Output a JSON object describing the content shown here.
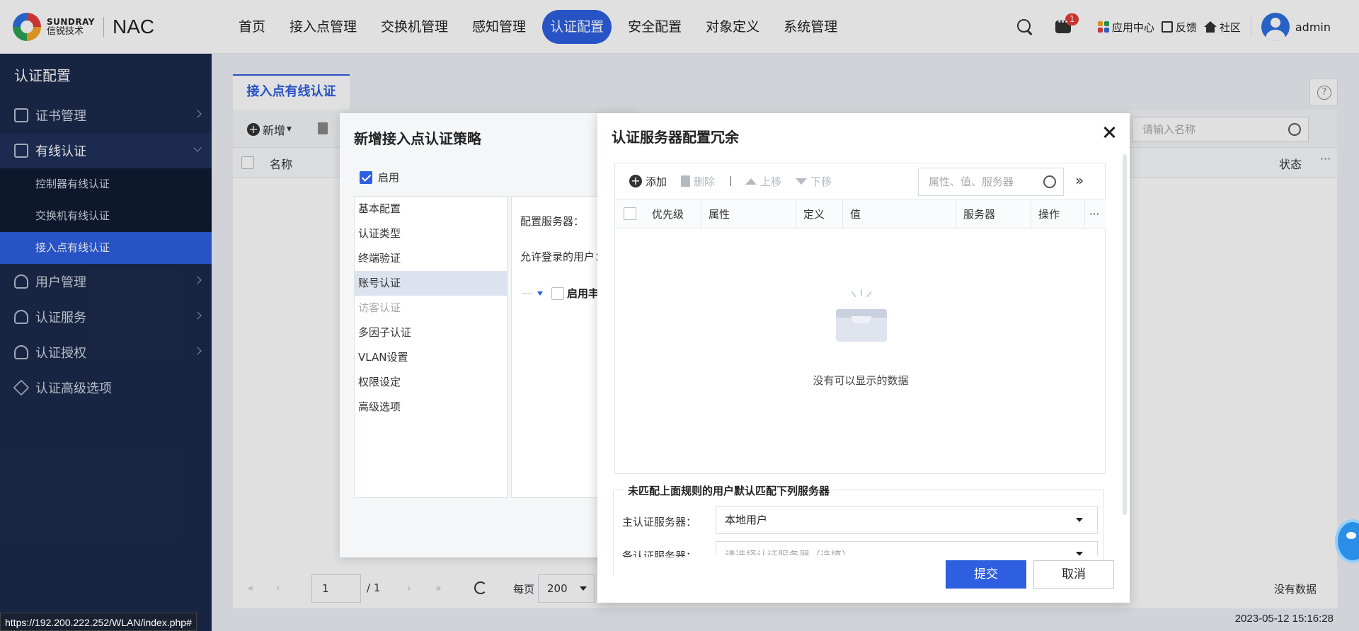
{
  "header": {
    "brand_en": "SUNDRAY",
    "brand_cn": "信锐技术",
    "product": "NAC",
    "nav": [
      "首页",
      "接入点管理",
      "交换机管理",
      "感知管理",
      "认证配置",
      "安全配置",
      "对象定义",
      "系统管理"
    ],
    "nav_active_index": 4,
    "badge_count": "1",
    "app_center": "应用中心",
    "feedback": "反馈",
    "community": "社区",
    "user": "admin"
  },
  "sidebar": {
    "title": "认证配置",
    "items": [
      {
        "label": "证书管理",
        "icon": "certificate-icon"
      },
      {
        "label": "有线认证",
        "icon": "wired-icon",
        "open": true
      },
      {
        "label": "用户管理",
        "icon": "user-icon"
      },
      {
        "label": "认证服务",
        "icon": "user-service-icon"
      },
      {
        "label": "认证授权",
        "icon": "user-auth-icon"
      },
      {
        "label": "认证高级选项",
        "icon": "diamond-icon"
      }
    ],
    "sub_items": [
      "控制器有线认证",
      "交换机有线认证",
      "接入点有线认证"
    ],
    "sub_active_index": 2
  },
  "status_url": "https://192.200.222.252/WLAN/index.php#",
  "main": {
    "tab": "接入点有线认证",
    "toolbar_add": "新增",
    "search_placeholder": "请输入名称",
    "col_name": "名称",
    "col_status": "状态",
    "pager": {
      "page": "1",
      "total": "/ 1",
      "per_page_label": "每页",
      "page_size": "200",
      "no_data": "没有数据"
    }
  },
  "dialog_policy": {
    "title": "新增接入点认证策略",
    "enable_label": "启用",
    "enabled": true,
    "menu": [
      "基本配置",
      "认证类型",
      "终端验证",
      "账号认证",
      "访客认证",
      "多因子认证",
      "VLAN设置",
      "权限设定",
      "高级选项"
    ],
    "menu_active_index": 3,
    "menu_disabled_index": 4,
    "content_server_label": "配置服务器：",
    "content_users_label": "允许登录的用户：",
    "content_enable_partial": "启用丰"
  },
  "dialog_redundancy": {
    "title": "认证服务器配置冗余",
    "toolbar": {
      "add": "添加",
      "delete": "删除",
      "move_up": "上移",
      "move_down": "下移",
      "search_placeholder": "属性、值、服务器",
      "expand": "»"
    },
    "columns": [
      "优先级",
      "属性",
      "定义",
      "值",
      "服务器",
      "操作",
      "···"
    ],
    "empty_text": "没有可以显示的数据",
    "fallback_legend": "未匹配上面规则的用户默认匹配下列服务器",
    "primary_label": "主认证服务器：",
    "primary_value": "本地用户",
    "backup_label": "备认证服务器：",
    "backup_placeholder": "请选择认证服务器（选填）",
    "submit": "提交",
    "cancel": "取消"
  },
  "datetime": "2023-05-12 15:16:28",
  "colors": {
    "accent": "#2d5fe0",
    "sidebar_bg": "#1c2b4c",
    "sub_bg": "#111c33"
  }
}
